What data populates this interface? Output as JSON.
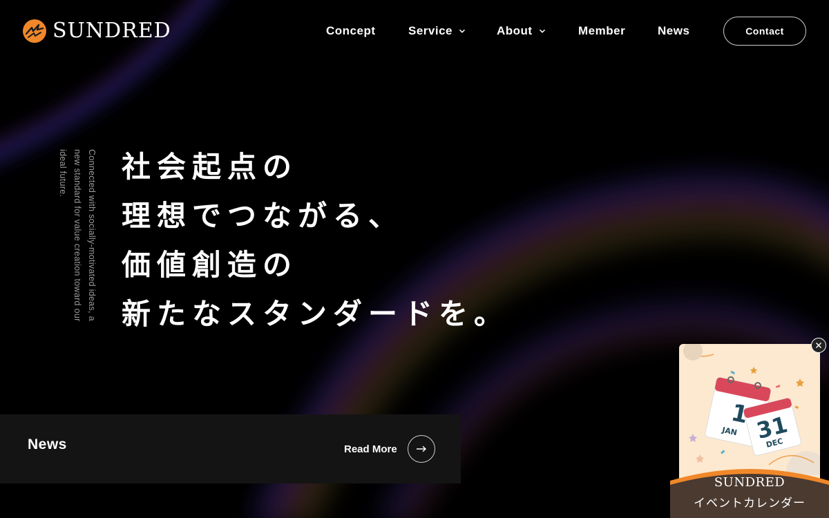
{
  "header": {
    "logo_text": "SUNDRED",
    "nav": [
      {
        "label": "Concept"
      },
      {
        "label": "Service"
      },
      {
        "label": "About"
      },
      {
        "label": "Member"
      },
      {
        "label": "News"
      }
    ],
    "contact_label": "Contact"
  },
  "hero": {
    "tagline_en": "Connected with socially-motivated ideas, a new standard for value creation toward our ideal future.",
    "lines": [
      "社会起点の",
      "理想でつながる、",
      "価値創造の",
      "新たなスタンダードを。"
    ]
  },
  "news": {
    "title": "News",
    "read_more_label": "Read More"
  },
  "event_widget": {
    "calendar_day1": "1",
    "calendar_month1": "JAN",
    "calendar_day2": "31",
    "calendar_month2": "DEC",
    "label_line1": "SUNDRED",
    "label_line2": "イベントカレンダー"
  },
  "colors": {
    "brand_orange": "#f0882a",
    "background": "#000000",
    "news_bar": "#141414",
    "widget_cream": "#fde9cf"
  }
}
